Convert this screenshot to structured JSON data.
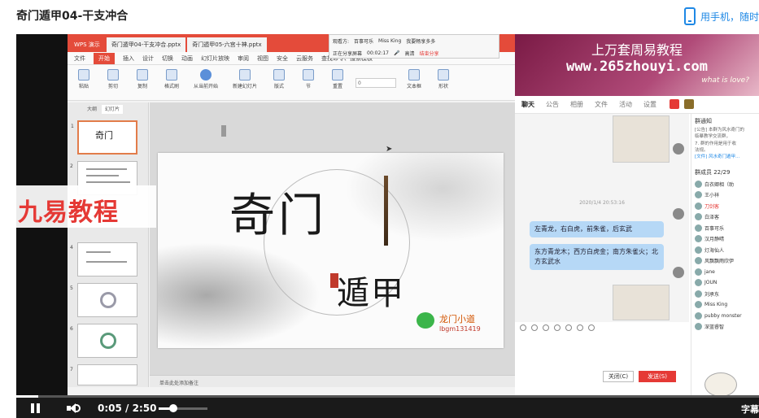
{
  "page": {
    "title": "奇门遁甲04-干支冲合",
    "phone_link": "用手机，随时"
  },
  "wps": {
    "tabs": [
      "WPS 演示",
      "奇门遁甲04-干支冲合.pptx",
      "奇门遁甲05-六宫十神.pptx"
    ],
    "menu": [
      "文件",
      "开始",
      "插入",
      "设计",
      "切换",
      "动画",
      "幻灯片放映",
      "审阅",
      "视图",
      "安全",
      "云服务"
    ],
    "search": "查找命令、搜索模板",
    "ribbon": [
      "粘贴",
      "剪切",
      "复制",
      "格式刷",
      "从当前开始",
      "新建幻灯片",
      "版式",
      "节",
      "重置",
      "文本框",
      "形状"
    ],
    "font_size": "0",
    "thumb_tabs": [
      "大纲",
      "幻灯片"
    ],
    "thumb_title": "奇门",
    "notes": "单击此处添加备注"
  },
  "slide": {
    "title": "奇门",
    "subtitle": "遁甲",
    "brand": "龙门小道",
    "brand_id": "lbgm131419"
  },
  "share_bar": {
    "viewers_label": "观看方:",
    "viewers": [
      "百事可乐",
      "Miss  King",
      "我要畅享多多"
    ],
    "status": "正在分享屏幕",
    "timer": "00:02:17",
    "mute": "高清",
    "stop": "结束分享"
  },
  "watermark": "九易教程",
  "banner": {
    "title": "上万套周易教程",
    "url": "www.265zhouyi.com",
    "tag": "what is love?"
  },
  "chat": {
    "tabs": [
      "聊天",
      "公告",
      "相册",
      "文件",
      "活动",
      "设置"
    ],
    "timestamp": "2020/1/4 20:53:16",
    "messages": [
      "左青龙，右白虎，前朱雀，后玄武",
      "东方青龙木；西方白虎金；南方朱雀火；北方玄武水"
    ],
    "close_label": "关闭(C)",
    "send_label": "发送(S)",
    "group_notice_title": "群通知",
    "group_notice_lines": [
      "[公告] 本群为风水奇门的",
      "临摹教学交流群，",
      "7. 群的作用是用于收",
      "法规。",
      "[文件] 风水奇门遁甲..."
    ],
    "members_title": "群成员 22/29",
    "members": [
      "白衣卿相（助",
      "王小祥",
      "刀剑客",
      "白泽客",
      "百事可乐",
      "汉月静晴",
      "灯海仙人",
      "风飘飘雨欣伊",
      "jane",
      "JOUN",
      "刘承东",
      "Miss  King",
      "pubby monster",
      "深蓝睿智"
    ]
  },
  "player": {
    "current_time": "0:05",
    "separator": "/",
    "duration": "2:50",
    "progress_fraction": 0.03,
    "subtitle_btn": "字幕",
    "volume_fraction": 0.3
  },
  "colors": {
    "wps_red": "#e44b3a",
    "link_blue": "#1e88e5",
    "bubble_blue": "#b6d8f6",
    "watermark_red": "#e53935"
  }
}
